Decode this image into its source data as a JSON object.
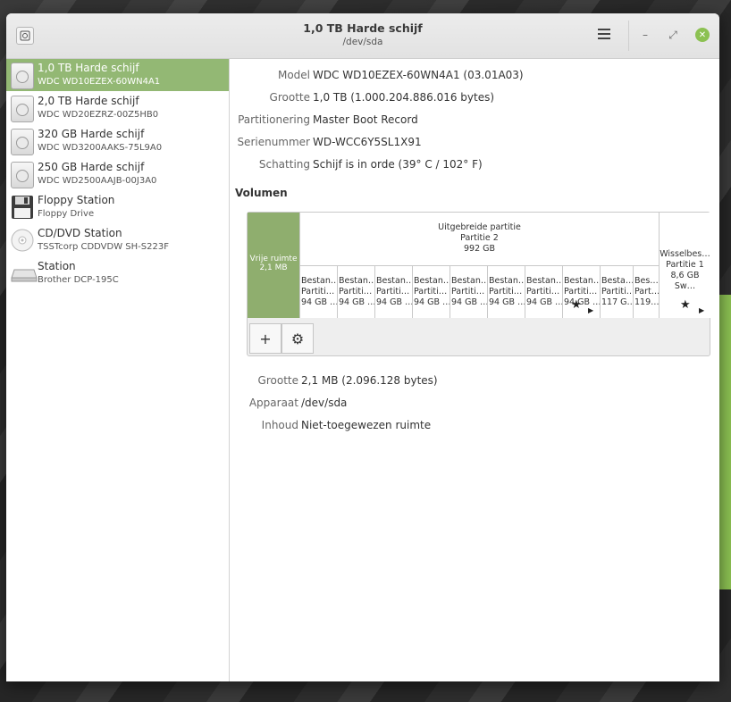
{
  "window": {
    "title": "1,0 TB Harde schijf",
    "subtitle": "/dev/sda",
    "buttons": {
      "minimize": "–",
      "restore": "⤢",
      "close": "✕"
    }
  },
  "drives": [
    {
      "name": "1,0 TB Harde schijf",
      "desc": "WDC WD10EZEX-60WN4A1",
      "icon": "hard-disk-icon",
      "selected": true
    },
    {
      "name": "2,0 TB Harde schijf",
      "desc": "WDC WD20EZRZ-00Z5HB0",
      "icon": "hard-disk-icon"
    },
    {
      "name": "320 GB Harde schijf",
      "desc": "WDC WD3200AAKS-75L9A0",
      "icon": "hard-disk-icon"
    },
    {
      "name": "250 GB Harde schijf",
      "desc": "WDC WD2500AAJB-00J3A0",
      "icon": "hard-disk-icon"
    },
    {
      "name": "Floppy Station",
      "desc": "Floppy Drive",
      "icon": "floppy-icon"
    },
    {
      "name": "CD/DVD Station",
      "desc": "TSSTcorp CDDVDW SH-S223F",
      "icon": "optical-disc-icon"
    },
    {
      "name": "Station",
      "desc": "Brother DCP-195C",
      "icon": "removable-drive-icon"
    }
  ],
  "disk_props": [
    {
      "label": "Model",
      "value": "WDC WD10EZEX-60WN4A1 (03.01A03)"
    },
    {
      "label": "Grootte",
      "value": "1,0 TB (1.000.204.886.016 bytes)"
    },
    {
      "label": "Partitionering",
      "value": "Master Boot Record"
    },
    {
      "label": "Serienummer",
      "value": "WD-WCC6Y5SL1X91"
    },
    {
      "label": "Schatting",
      "value": "Schijf is in orde (39° C / 102° F)"
    }
  ],
  "volumes_title": "Volumen",
  "volumes": {
    "free": {
      "line1": "Vrije ruimte",
      "line2": "2,1 MB"
    },
    "extended": {
      "line1": "Uitgebreide partitie",
      "line2": "Partitie 2",
      "line3": "992 GB"
    },
    "logical": [
      {
        "l1": "Bestan…",
        "l2": "Partiti…",
        "l3": "94 GB …"
      },
      {
        "l1": "Bestan…",
        "l2": "Partiti…",
        "l3": "94 GB …"
      },
      {
        "l1": "Bestan…",
        "l2": "Partiti…",
        "l3": "94 GB …"
      },
      {
        "l1": "Bestan…",
        "l2": "Partiti…",
        "l3": "94 GB …"
      },
      {
        "l1": "Bestan…",
        "l2": "Partiti…",
        "l3": "94 GB …"
      },
      {
        "l1": "Bestan…",
        "l2": "Partiti…",
        "l3": "94 GB …"
      },
      {
        "l1": "Bestan…",
        "l2": "Partiti…",
        "l3": "94 GB …"
      },
      {
        "l1": "Bestan…",
        "l2": "Partiti…",
        "l3": "94 GB …"
      },
      {
        "l1": "Besta…",
        "l2": "Partiti…",
        "l3": "117 G…"
      },
      {
        "l1": "Bes…",
        "l2": "Part…",
        "l3": "119…"
      }
    ],
    "swap": {
      "line1": "Wisselbes…",
      "line2": "Partitie 1",
      "line3": "8,6 GB Sw…"
    },
    "tools": {
      "add": "+",
      "settings": "⚙"
    }
  },
  "selected_props": [
    {
      "label": "Grootte",
      "value": "2,1 MB (2.096.128 bytes)"
    },
    {
      "label": "Apparaat",
      "value": "/dev/sda"
    },
    {
      "label": "Inhoud",
      "value": "Niet-toegewezen ruimte"
    }
  ]
}
